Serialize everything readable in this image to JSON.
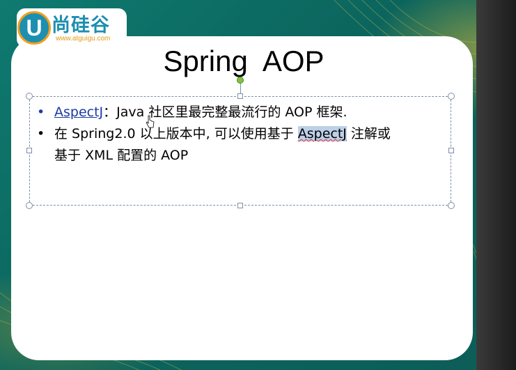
{
  "logo": {
    "letter": "U",
    "brand_cn": "尚硅谷",
    "url": "www.atguigu.com"
  },
  "slide": {
    "title": "Spring  AOP",
    "bullets": [
      {
        "link": "AspectJ",
        "text": "：Java 社区里最完整最流行的 AOP 框架."
      },
      {
        "pre": "在 Spring2.0 以上版本中, 可以使用基于 ",
        "highlight": "AspectJ",
        "post": " 注解或",
        "line2": "基于 XML 配置的 AOP"
      }
    ],
    "bullet_char": "•"
  },
  "icons": {
    "cursor": "hand-pointer-icon"
  }
}
